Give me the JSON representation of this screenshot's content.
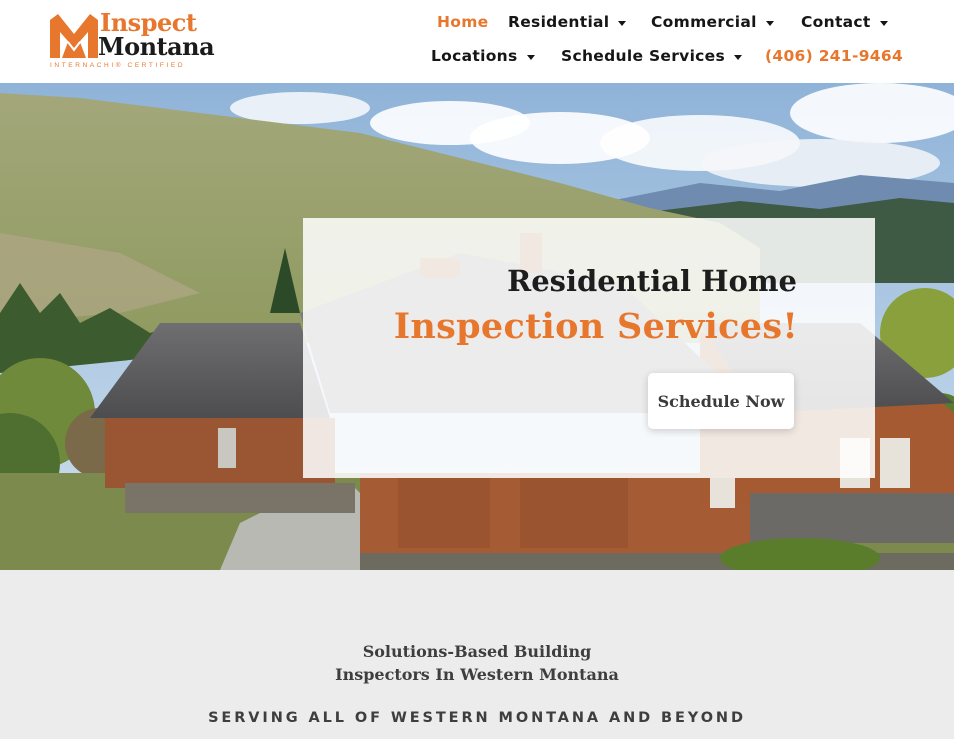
{
  "logo": {
    "line1": "Inspect",
    "line2": "Montana",
    "tagline": "INTERNACHI® CERTIFIED",
    "icon": "mountain-m-logo-icon"
  },
  "nav": {
    "row1": [
      {
        "label": "Home",
        "active": true,
        "dropdown": false
      },
      {
        "label": "Residential",
        "dropdown": true
      },
      {
        "label": "Commercial",
        "dropdown": true
      },
      {
        "label": "Contact",
        "dropdown": true
      }
    ],
    "row2": [
      {
        "label": "Locations",
        "dropdown": true
      },
      {
        "label": "Schedule Services",
        "dropdown": true
      }
    ],
    "phone": "(406) 241-9464",
    "caret_icon": "caret-down-icon"
  },
  "hero": {
    "title_line1": "Residential Home",
    "title_line2": "Inspection Services!",
    "cta": "Schedule Now"
  },
  "lower": {
    "heading_line1": "Solutions-Based Building",
    "heading_line2": "Inspectors In Western Montana",
    "subheading": "SERVING ALL OF WESTERN MONTANA AND BEYOND"
  },
  "colors": {
    "accent": "#e8772e",
    "text_dark": "#161616",
    "section_bg": "#ececec"
  }
}
